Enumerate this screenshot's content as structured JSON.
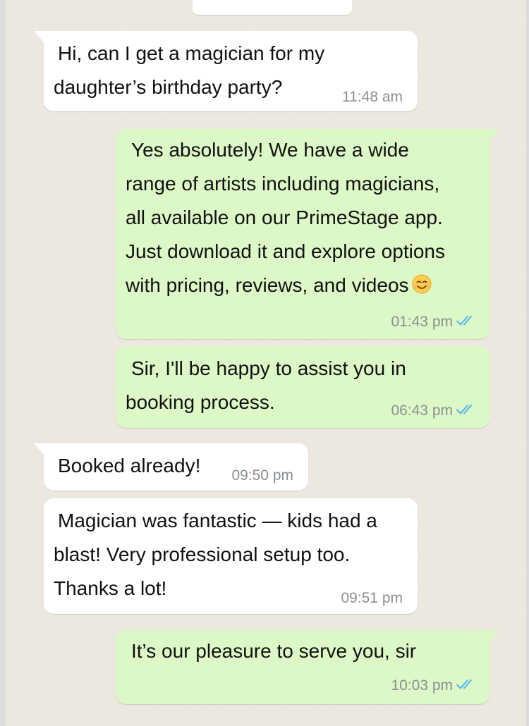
{
  "messages": [
    {
      "direction": "incoming",
      "lines": [
        "Hi, can I get a magician for my",
        "daughter’s birthday party?"
      ],
      "time": "11:48 am"
    },
    {
      "direction": "outgoing",
      "lines": [
        "Yes absolutely! We have a wide",
        "range of artists including magicians,",
        "all available on our PrimeStage app.",
        "Just download it and explore options",
        "with pricing, reviews, and videos"
      ],
      "emoji": "smiling-face-icon",
      "time": "01:43 pm",
      "status": "read"
    },
    {
      "direction": "outgoing",
      "lines": [
        "Sir, I'll be happy to assist you in",
        "booking process."
      ],
      "time": "06:43 pm",
      "status": "read"
    },
    {
      "direction": "incoming",
      "lines": [
        "Booked already!"
      ],
      "time": "09:50 pm"
    },
    {
      "direction": "incoming",
      "lines": [
        "Magician was fantastic — kids had a",
        "blast! Very professional setup too.",
        "Thanks a lot!"
      ],
      "time": "09:51 pm"
    },
    {
      "direction": "outgoing",
      "lines": [
        "It’s our pleasure to serve you, sir"
      ],
      "time": "10:03 pm",
      "status": "read"
    }
  ],
  "colors": {
    "incoming_bubble": "#ffffff",
    "outgoing_bubble": "#dcf8c6",
    "timestamp": "#8a8f93",
    "read_ticks": "#4fb6ec",
    "chat_background": "#ece7df"
  }
}
